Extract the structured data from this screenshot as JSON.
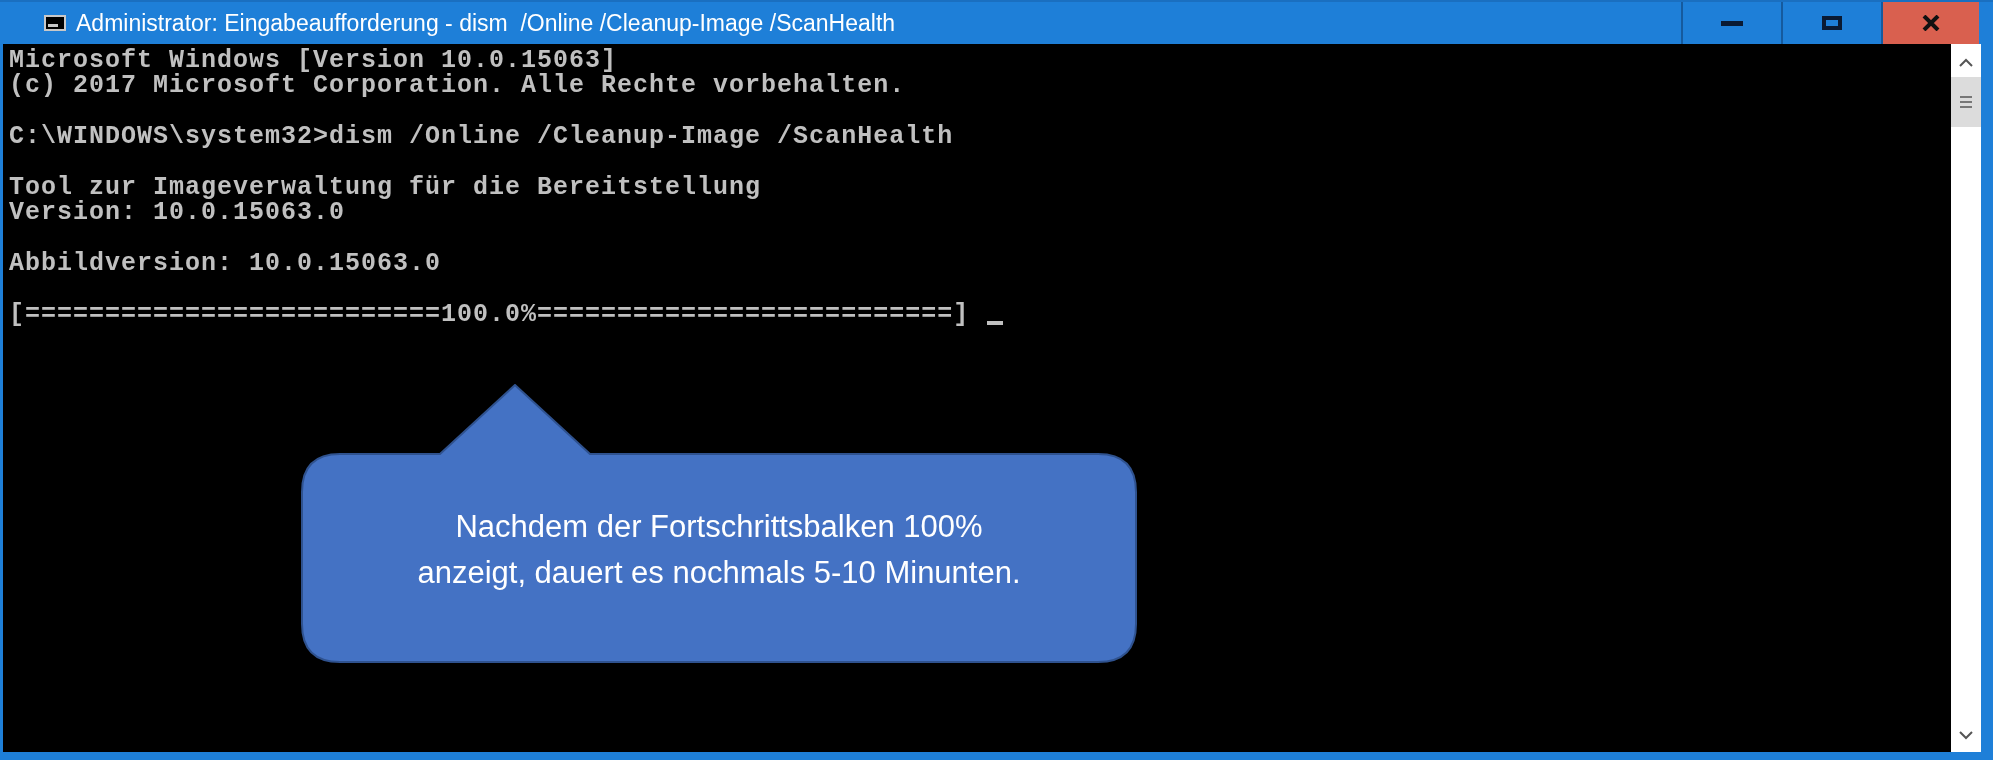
{
  "window": {
    "title": "Administrator: Eingabeaufforderung - dism  /Online /Cleanup-Image /ScanHealth"
  },
  "console": {
    "blocks": [
      [
        "Microsoft Windows [Version 10.0.15063]",
        "(c) 2017 Microsoft Corporation. Alle Rechte vorbehalten."
      ],
      [
        "C:\\WINDOWS\\system32>dism /Online /Cleanup-Image /ScanHealth"
      ],
      [
        "Tool zur Imageverwaltung für die Bereitstellung",
        "Version: 10.0.15063.0"
      ],
      [
        "Abbildversion: 10.0.15063.0"
      ],
      [
        "[==========================100.0%==========================]"
      ]
    ]
  },
  "callout": {
    "lines": [
      "Nachdem der Fortschrittsbalken 100%",
      "anzeigt, dauert es nochmals 5-10 Minunten."
    ]
  }
}
